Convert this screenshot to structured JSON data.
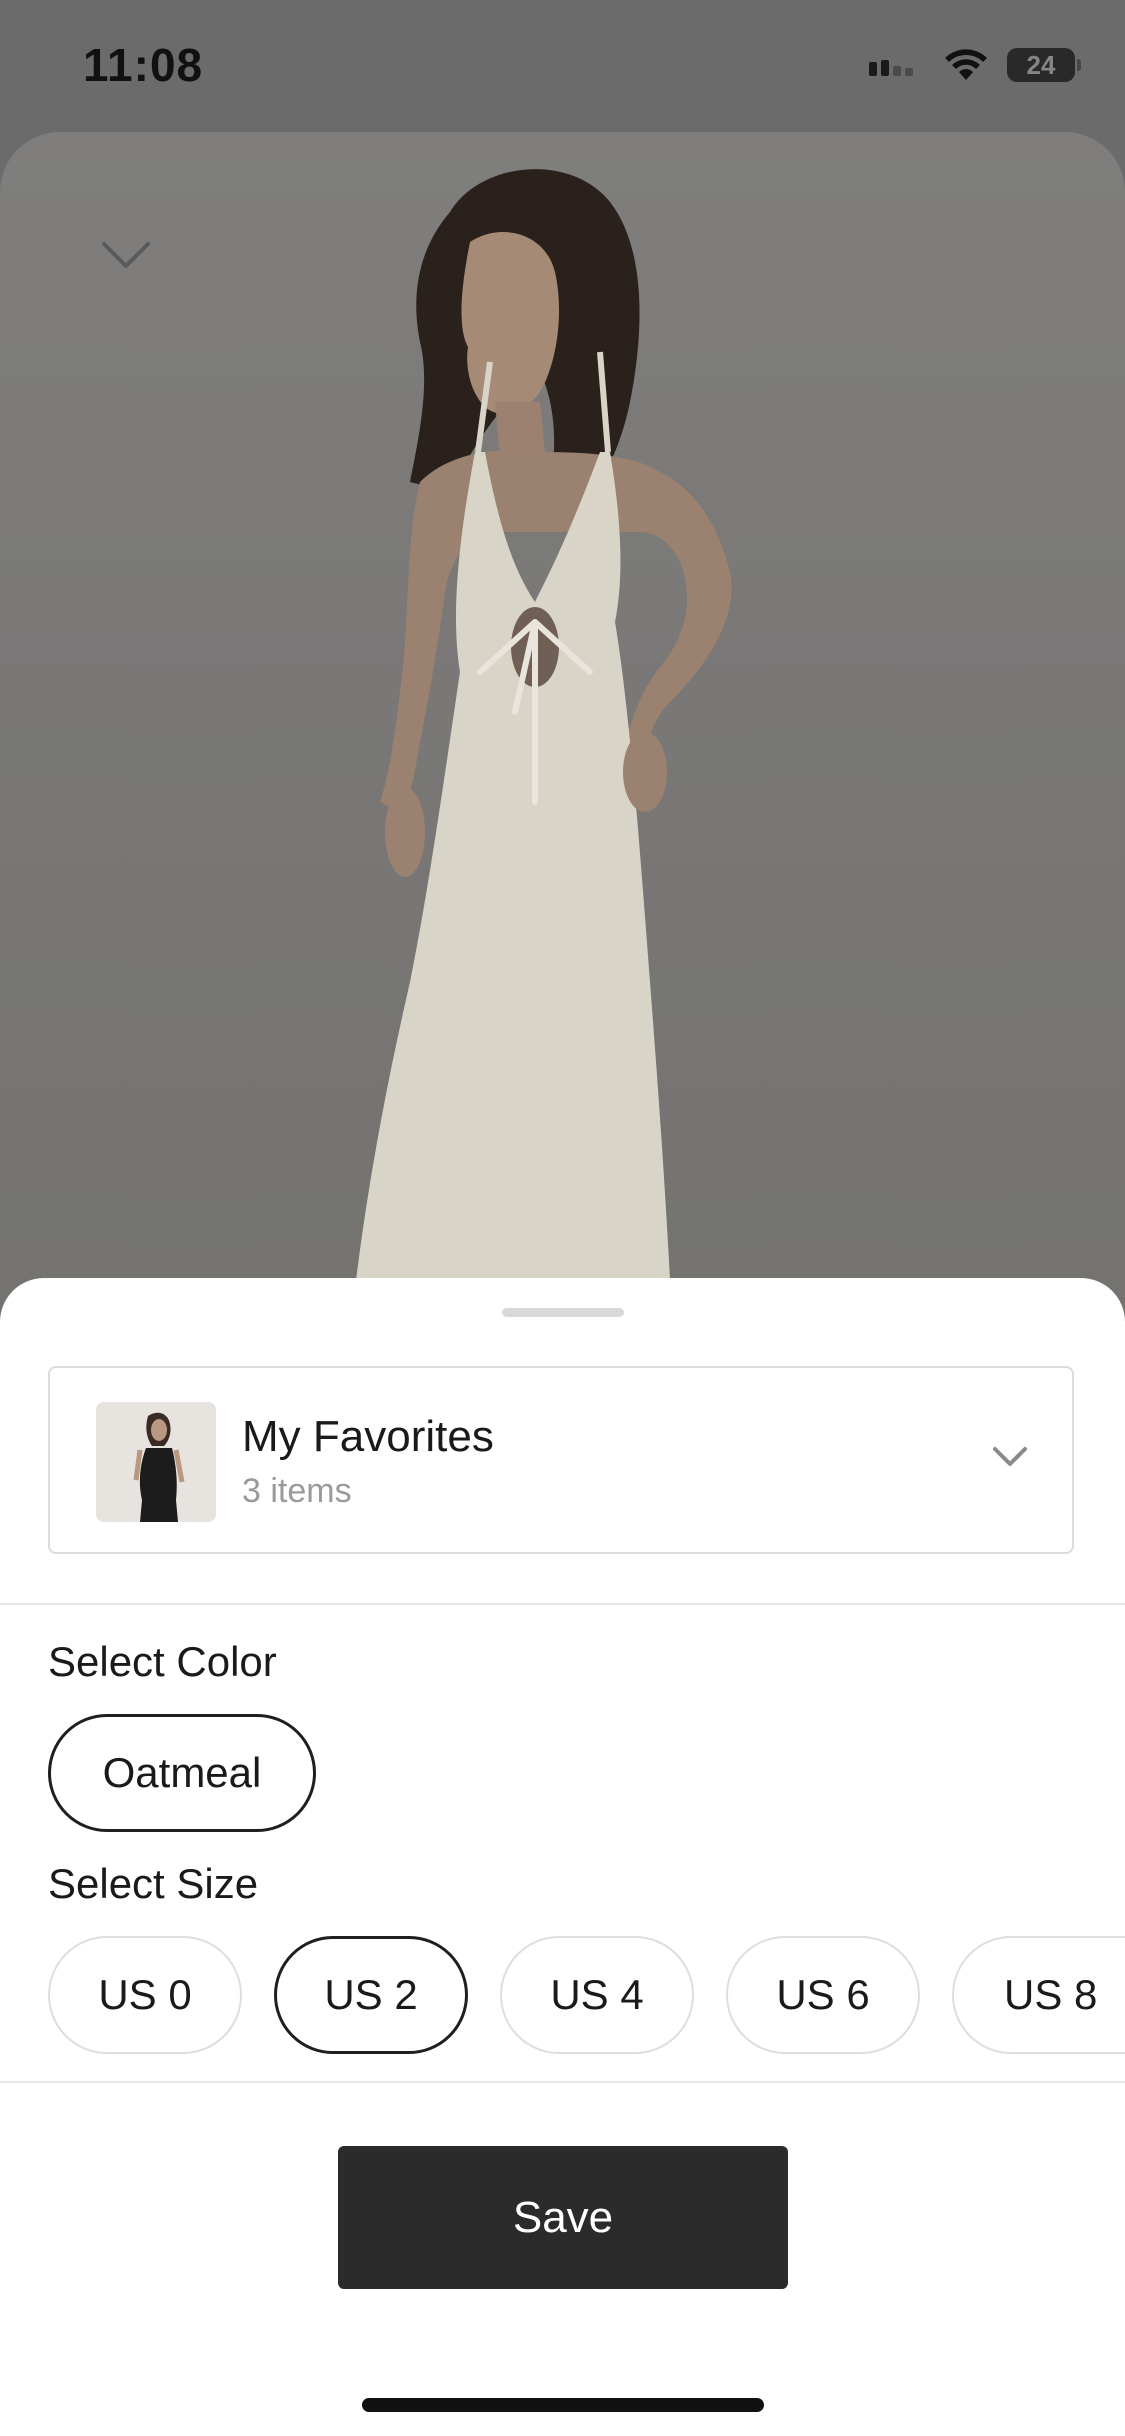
{
  "status_bar": {
    "time": "11:08",
    "battery": "24"
  },
  "product": {
    "color_name": "Oatmeal"
  },
  "collection": {
    "name": "My Favorites",
    "count": "3 items"
  },
  "color_section": {
    "label": "Select Color",
    "options": [
      "Oatmeal"
    ],
    "selected": "Oatmeal"
  },
  "size_section": {
    "label": "Select Size",
    "options": [
      "US 0",
      "US 2",
      "US 4",
      "US 6",
      "US 8"
    ],
    "selected": "US 2"
  },
  "actions": {
    "save_label": "Save"
  },
  "colors": {
    "button_bg": "#2b2b2b",
    "selected_border": "#1f1f1f",
    "muted_text": "#9a9a9a"
  },
  "icons": {
    "collapse": "chevron-down-icon",
    "collection_dropdown": "chevron-down-icon",
    "signal": "cellular-signal-icon",
    "wifi": "wifi-icon",
    "battery": "battery-icon"
  }
}
